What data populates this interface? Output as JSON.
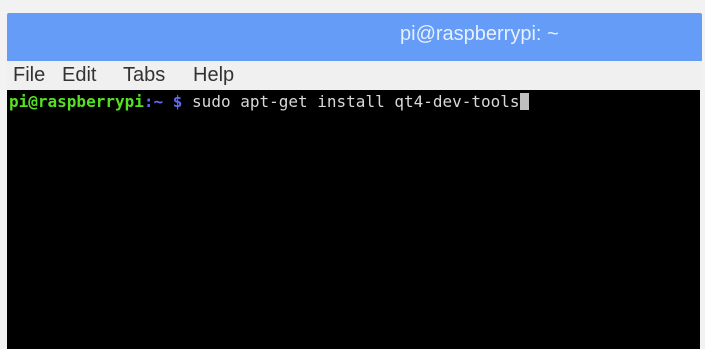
{
  "window": {
    "title": "pi@raspberrypi: ~"
  },
  "menu": {
    "items": [
      "File",
      "Edit",
      "Tabs",
      "Help"
    ]
  },
  "terminal": {
    "prompt_user_host": "pi@raspberrypi",
    "prompt_path": ":~",
    "prompt_symbol": "$",
    "command": "sudo apt-get install qt4-dev-tools"
  },
  "colors": {
    "titlebar": "#649cf8",
    "terminal_bg": "#000000",
    "prompt_user": "#56e022",
    "prompt_path": "#5f6bf4",
    "command_text": "#d8d8d8"
  }
}
